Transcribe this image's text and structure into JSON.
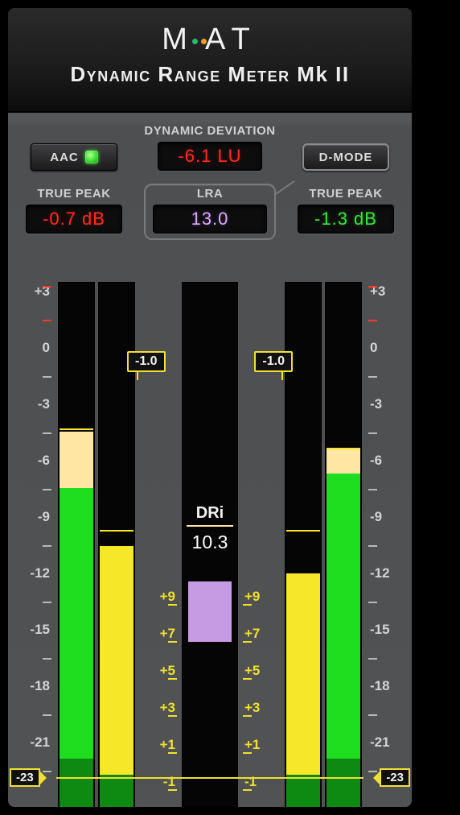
{
  "brand": {
    "name": "MAAT"
  },
  "subtitle_a": "Dynamic Range Meter ",
  "subtitle_b": "Mk II",
  "controls": {
    "dyn_dev_label": "DYNAMIC DEVIATION",
    "dyn_dev_value": "-6.1 LU",
    "aac_label": "AAC",
    "dmode_label": "D-MODE",
    "lra_label": "LRA",
    "lra_value": "13.0",
    "tp_left_label": "TRUE PEAK",
    "tp_left_value": "-0.7 dB",
    "tp_right_label": "TRUE PEAK",
    "tp_right_value": "-1.3 dB"
  },
  "scale": {
    "ticks": [
      "+3",
      "0",
      "-3",
      "-6",
      "-9",
      "-12",
      "-15",
      "-18",
      "-21"
    ],
    "ref_value": "-23"
  },
  "inner_scale": {
    "ticks": [
      "+9",
      "+7",
      "+5",
      "+3",
      "+1",
      "-1"
    ]
  },
  "peak_flags": {
    "left": "-1.0",
    "right": "-1.0"
  },
  "dri": {
    "label": "DRi",
    "value": "10.3"
  },
  "chart_data": {
    "type": "bar",
    "title": "Dynamic Range Meter Mk II",
    "y_unit": "dBFS / LU",
    "ylim_outer_db": [
      -24.5,
      3.5
    ],
    "ylim_inner_lu": [
      -2,
      10
    ],
    "reference_level_db": -23,
    "channels": {
      "left": {
        "true_peak_db": -0.7,
        "peak_hold_db": -1.0,
        "outer_meter_top_db": -4.8,
        "outer_meter_transition_db": -7.8,
        "inner_meter_top_db": -10.4,
        "inner_meter_peak_lu": 9.0,
        "dark_green_top_db": -22.0
      },
      "right": {
        "true_peak_db": -1.3,
        "peak_hold_db": -1.0,
        "outer_meter_top_db": -5.8,
        "outer_meter_transition_db": -7.6,
        "inner_meter_top_db": -11.8,
        "inner_meter_peak_lu": 9.0,
        "dark_green_top_db": -22.0
      }
    },
    "center": {
      "lra_lu": 13.0,
      "dynamic_deviation_lu": -6.1,
      "dri_value": 10.3,
      "violet_block_top_db": -13.4,
      "violet_block_bottom_db": -16.4
    }
  }
}
